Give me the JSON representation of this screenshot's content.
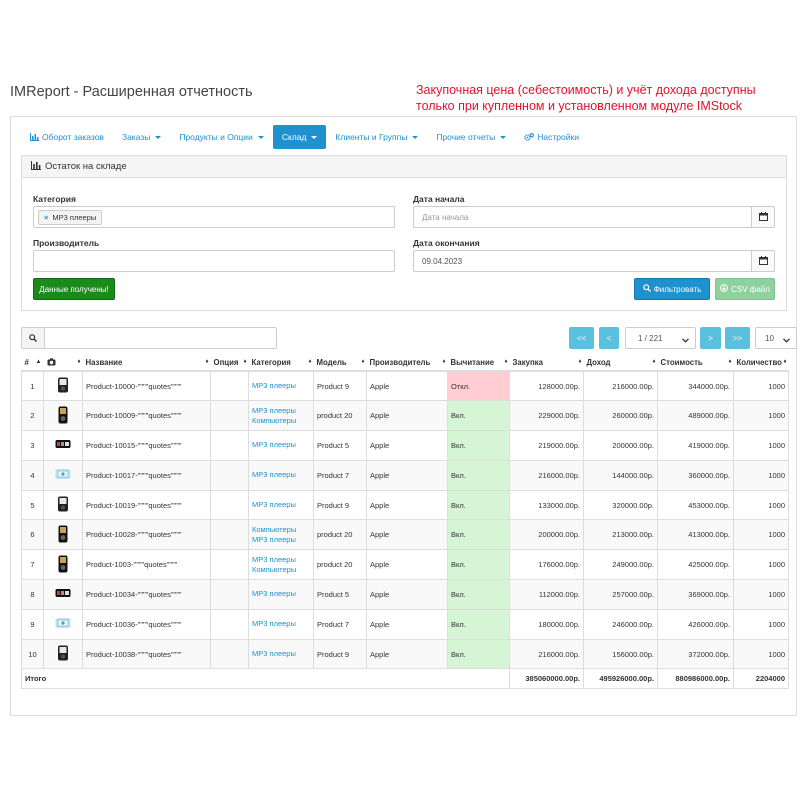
{
  "app_title": "IMReport - Расширенная отчетность",
  "notice": "Закупочная цена (себестоимость) и учёт дохода доступны только при купленном и установленном модуле IMStock",
  "tabs": [
    {
      "label": "Оборот заказов",
      "icon": "bar-chart-icon",
      "dropdown": false,
      "active": false
    },
    {
      "label": "Заказы",
      "dropdown": true,
      "active": false
    },
    {
      "label": "Продукты и Опции",
      "dropdown": true,
      "active": false
    },
    {
      "label": "Склад",
      "dropdown": true,
      "active": true
    },
    {
      "label": "Клиенты и Группы",
      "dropdown": true,
      "active": false
    },
    {
      "label": "Прочие отчеты",
      "dropdown": true,
      "active": false
    },
    {
      "label": "Настройки",
      "icon": "cogs-icon",
      "dropdown": false,
      "active": false
    }
  ],
  "filter": {
    "title": "Остаток на складе",
    "category_label": "Категория",
    "category_tag": "MP3 плееры",
    "manufacturer_label": "Производитель",
    "manufacturer_value": "",
    "date_start_label": "Дата начала",
    "date_start_placeholder": "Дата начала",
    "date_end_label": "Дата окончания",
    "date_end_value": "09.04.2023",
    "status_button": "Данные получены!",
    "filter_button": "Фильтровать",
    "csv_button": "CSV файл"
  },
  "pager": {
    "first": "<<",
    "prev": "<",
    "page": "1 / 221",
    "next": ">",
    "last": ">>",
    "per_page": "10"
  },
  "columns": [
    "#",
    "",
    "Название",
    "Опция",
    "Категория",
    "Модель",
    "Производитель",
    "Вычитание",
    "Закупка",
    "Доход",
    "Стоимость",
    "Количество"
  ],
  "rows": [
    {
      "n": "1",
      "img": "player-black",
      "name": "Product-10000-\"\"\"\"quotes\"\"\"\"",
      "option": "",
      "category": [
        "MP3 плееры"
      ],
      "model": "Product 9",
      "manufacturer": "Apple",
      "subtract": "Откл.",
      "subtract_on": false,
      "purchase": "128000.00р.",
      "income": "216000.00р.",
      "cost": "344000.00р.",
      "qty": "1000"
    },
    {
      "n": "2",
      "img": "player-tall",
      "name": "Product-10009-\"\"\"\"quotes\"\"\"\"",
      "option": "",
      "category": [
        "MP3 плееры",
        "Компьютеры"
      ],
      "model": "product 20",
      "manufacturer": "Apple",
      "subtract": "Вкл.",
      "subtract_on": true,
      "purchase": "229000.00р.",
      "income": "260000.00р.",
      "cost": "489000.00р.",
      "qty": "1000"
    },
    {
      "n": "3",
      "img": "player-wide",
      "name": "Product-10015-\"\"\"\"quotes\"\"\"\"",
      "option": "",
      "category": [
        "MP3 плееры"
      ],
      "model": "Product 5",
      "manufacturer": "Apple",
      "subtract": "Вкл.",
      "subtract_on": true,
      "purchase": "219000.00р.",
      "income": "200000.00р.",
      "cost": "419000.00р.",
      "qty": "1000"
    },
    {
      "n": "4",
      "img": "player-blue",
      "name": "Product-10017-\"\"\"\"quotes\"\"\"\"",
      "option": "",
      "category": [
        "MP3 плееры"
      ],
      "model": "Product 7",
      "manufacturer": "Apple",
      "subtract": "Вкл.",
      "subtract_on": true,
      "purchase": "216000.00р.",
      "income": "144000.00р.",
      "cost": "360000.00р.",
      "qty": "1000"
    },
    {
      "n": "5",
      "img": "player-black",
      "name": "Product-10019-\"\"\"\"quotes\"\"\"\"",
      "option": "",
      "category": [
        "MP3 плееры"
      ],
      "model": "Product 9",
      "manufacturer": "Apple",
      "subtract": "Вкл.",
      "subtract_on": true,
      "purchase": "133000.00р.",
      "income": "320000.00р.",
      "cost": "453000.00р.",
      "qty": "1000"
    },
    {
      "n": "6",
      "img": "player-tall",
      "name": "Product-10028-\"\"\"\"quotes\"\"\"\"",
      "option": "",
      "category": [
        "Компьютеры",
        "MP3 плееры"
      ],
      "model": "product 20",
      "manufacturer": "Apple",
      "subtract": "Вкл.",
      "subtract_on": true,
      "purchase": "200000.00р.",
      "income": "213000.00р.",
      "cost": "413000.00р.",
      "qty": "1000"
    },
    {
      "n": "7",
      "img": "player-tall",
      "name": "Product-1003-\"\"\"\"quotes\"\"\"\"",
      "option": "",
      "category": [
        "MP3 плееры",
        "Компьютеры"
      ],
      "model": "product 20",
      "manufacturer": "Apple",
      "subtract": "Вкл.",
      "subtract_on": true,
      "purchase": "176000.00р.",
      "income": "249000.00р.",
      "cost": "425000.00р.",
      "qty": "1000"
    },
    {
      "n": "8",
      "img": "player-wide",
      "name": "Product-10034-\"\"\"\"quotes\"\"\"\"",
      "option": "",
      "category": [
        "MP3 плееры"
      ],
      "model": "Product 5",
      "manufacturer": "Apple",
      "subtract": "Вкл.",
      "subtract_on": true,
      "purchase": "112000.00р.",
      "income": "257000.00р.",
      "cost": "369000.00р.",
      "qty": "1000"
    },
    {
      "n": "9",
      "img": "player-blue",
      "name": "Product-10036-\"\"\"\"quotes\"\"\"\"",
      "option": "",
      "category": [
        "MP3 плееры"
      ],
      "model": "Product 7",
      "manufacturer": "Apple",
      "subtract": "Вкл.",
      "subtract_on": true,
      "purchase": "180000.00р.",
      "income": "246000.00р.",
      "cost": "426000.00р.",
      "qty": "1000"
    },
    {
      "n": "10",
      "img": "player-black",
      "name": "Product-10038-\"\"\"\"quotes\"\"\"\"",
      "option": "",
      "category": [
        "MP3 плееры"
      ],
      "model": "Product 9",
      "manufacturer": "Apple",
      "subtract": "Вкл.",
      "subtract_on": true,
      "purchase": "216000.00р.",
      "income": "156000.00р.",
      "cost": "372000.00р.",
      "qty": "1000"
    }
  ],
  "totals": {
    "label": "Итого",
    "purchase": "385060000.00р.",
    "income": "495926000.00р.",
    "cost": "880986000.00р.",
    "qty": "2204000"
  },
  "colors": {
    "accent": "#1e91cf",
    "notice": "#e8102b",
    "success": "#1b8a1b",
    "subtract_off": "#ffcdd2",
    "subtract_on": "#d5f5d5"
  }
}
